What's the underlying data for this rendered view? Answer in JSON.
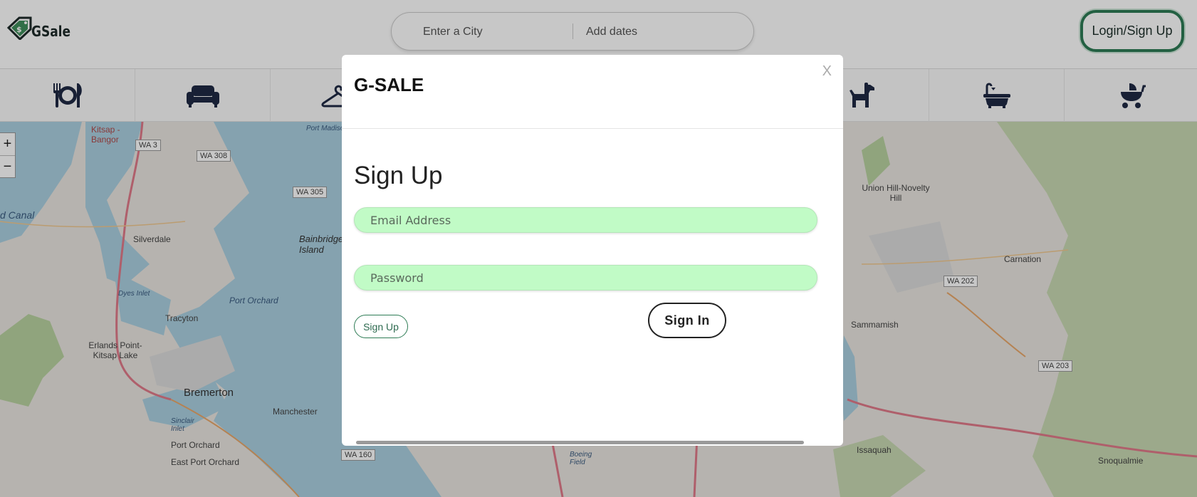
{
  "app": {
    "logo_text": "GSale"
  },
  "search": {
    "city_placeholder": "Enter a City",
    "dates_placeholder": "Add dates"
  },
  "header": {
    "login_label": "Login/Sign Up"
  },
  "categories": [
    {
      "icon": "dining-icon"
    },
    {
      "icon": "sofa-icon"
    },
    {
      "icon": "hanger-icon"
    },
    {
      "icon": "dog-icon"
    },
    {
      "icon": "bathtub-icon"
    },
    {
      "icon": "stroller-icon"
    }
  ],
  "map": {
    "zoom_in": "+",
    "zoom_out": "−",
    "labels": [
      "Kitsap - Bangor",
      "Silverdale",
      "Bainbridge Island",
      "Port Orchard",
      "Tracyton",
      "Erlands Point-Kitsap Lake",
      "Bremerton",
      "Manchester",
      "Port Orchard",
      "East Port Orchard",
      "Union Hill-Novelty Hill",
      "Carnation",
      "Sammamish",
      "Issaquah",
      "Snoqualmie",
      "d Canal",
      "Dyes Inlet",
      "Sinclair Inlet",
      "Boeing Field",
      "Port Madison"
    ],
    "shields": [
      "WA 3",
      "WA 308",
      "WA 305",
      "WA 160",
      "WA 202",
      "WA 203"
    ]
  },
  "modal": {
    "title": "G-SALE",
    "close_label": "X",
    "heading": "Sign Up",
    "email_placeholder": "Email Address",
    "password_placeholder": "Password",
    "signup_label": "Sign Up",
    "signin_label": "Sign In"
  },
  "colors": {
    "accent": "#2e7c55",
    "field_bg": "#c1fbc6",
    "icon": "#1f2a44"
  }
}
